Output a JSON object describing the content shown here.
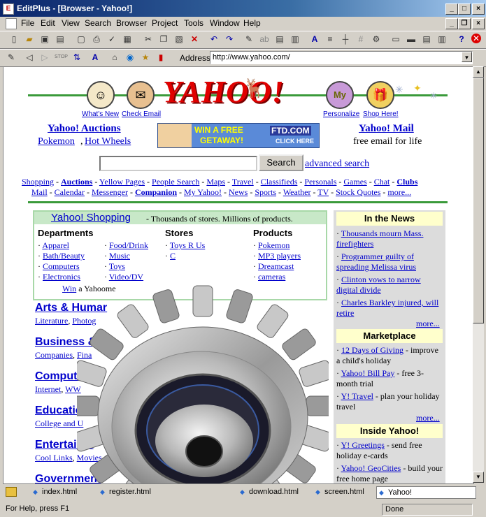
{
  "window": {
    "title": "EditPlus - [Browser - Yahoo!]",
    "controls": {
      "minimize": "_",
      "maximize": "□",
      "close": "×"
    }
  },
  "menu": [
    "File",
    "Edit",
    "View",
    "Search",
    "Browser",
    "Project",
    "Tools",
    "Window",
    "Help"
  ],
  "address": {
    "label": "Address",
    "value": "http://www.yahoo.com/"
  },
  "yahoo": {
    "logo": "YAHOO!",
    "top_links": [
      "What's New",
      "Check Email",
      "Personalize",
      "Shop Here!"
    ],
    "auctions": {
      "title": "Yahoo! Auctions",
      "items": [
        "Pokemon",
        "Hot Wheels"
      ]
    },
    "banner": {
      "line1": "WIN A FREE",
      "line2": "GETAWAY!",
      "brand": "FTD.COM",
      "cta": "CLICK HERE"
    },
    "mail": {
      "title": "Yahoo! Mail",
      "sub": "free email for life"
    },
    "search": {
      "button": "Search",
      "advanced": "advanced search"
    },
    "nav_row1": [
      "Shopping",
      "Auctions",
      "Yellow Pages",
      "People Search",
      "Maps",
      "Travel",
      "Classifieds",
      "Personals",
      "Games",
      "Chat",
      "Clubs"
    ],
    "nav_row2": [
      "Mail",
      "Calendar",
      "Messenger",
      "Companion",
      "My Yahoo!",
      "News",
      "Sports",
      "Weather",
      "TV",
      "Stock Quotes",
      "more..."
    ],
    "shopping": {
      "title": "Yahoo! Shopping",
      "tagline": "- Thousands of stores. Millions of products.",
      "departments_title": "Departments",
      "departments_a": [
        "Apparel",
        "Bath/Beauty",
        "Computers",
        "Electronics"
      ],
      "departments_b": [
        "Food/Drink",
        "Music",
        "Toys",
        "Video/DV"
      ],
      "stores_title": "Stores",
      "stores": [
        "Toys R Us",
        "C"
      ],
      "products_title": "Products",
      "products": [
        "Pokemon",
        "MP3 players",
        "Dreamcast",
        "cameras"
      ],
      "win_prefix": "Win",
      "win_text": "a Yahoome"
    },
    "categories": [
      {
        "title": "Arts & Humar",
        "sub": [
          "Literature",
          "Photog"
        ]
      },
      {
        "title": "Business &",
        "sub": [
          "Companies",
          "Fina"
        ]
      },
      {
        "title": "Computer",
        "sub": [
          "Internet",
          "WW"
        ]
      },
      {
        "title": "Educatio",
        "sub": [
          "College and U"
        ]
      },
      {
        "title": "Entertainm",
        "sub": [
          "Cool Links",
          "Movies"
        ]
      },
      {
        "title": "Government",
        "sub": []
      }
    ],
    "news": {
      "title": "In the News",
      "items": [
        "Thousands mourn Mass. firefighters",
        "Programmer guilty of spreading Melissa virus",
        "Clinton vows to narrow digital divide",
        "Charles Barkley injured, will retire"
      ],
      "more": "more..."
    },
    "marketplace": {
      "title": "Marketplace",
      "items": [
        {
          "link": "12 Days of Giving",
          "text": "- improve a child's holiday"
        },
        {
          "link": "Yahoo! Bill Pay",
          "text": "- free 3-month trial"
        },
        {
          "link": "Y! Travel",
          "text": "- plan your holiday travel"
        }
      ],
      "more": "more..."
    },
    "inside": {
      "title": "Inside Yahoo!",
      "items": [
        {
          "link": "Y! Greetings",
          "text": "- send free holiday e-cards"
        },
        {
          "link": "Yahoo! GeoCities",
          "text": "- build your free home page"
        }
      ]
    }
  },
  "doc_tabs": [
    "index.html",
    "register.html",
    "download.html",
    "screen.html",
    "Yahoo!"
  ],
  "status": {
    "help": "For Help, press F1",
    "state": "Done"
  }
}
